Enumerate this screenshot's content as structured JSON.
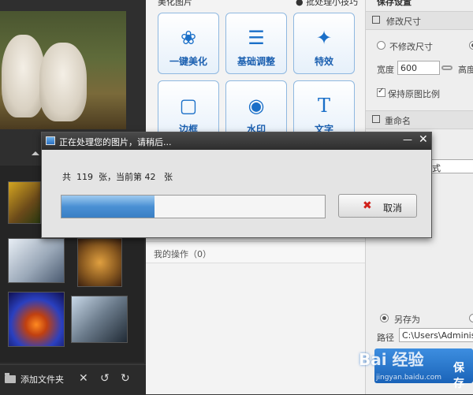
{
  "editor": {
    "section_title": "美化图片",
    "batch_label": "批处理小技巧",
    "tools": [
      {
        "label": "一键美化",
        "icon": "tulip-icon"
      },
      {
        "label": "基础调整",
        "icon": "sliders-icon"
      },
      {
        "label": "特效",
        "icon": "magic-wand-icon"
      },
      {
        "label": "边框",
        "icon": "frame-icon"
      },
      {
        "label": "水印",
        "icon": "watermark-icon"
      },
      {
        "label": "文字",
        "icon": "text-icon"
      }
    ],
    "ops_label": "我的操作（0）"
  },
  "left": {
    "add_folder_label": "添加文件夹"
  },
  "settings": {
    "title": "保存设置",
    "resize_header": "修改尺寸",
    "no_resize_label": "不修改尺寸",
    "width_label": "宽度",
    "width_value": "600",
    "height_label": "高度",
    "keep_ratio_label": "保持原图比例",
    "rename_header": "重命名",
    "format_fragment": "式",
    "save_as_label": "另存为",
    "path_label": "路径",
    "path_value": "C:\\Users\\Administra",
    "save_button": "保存"
  },
  "watermark": {
    "brand": "Bai 经验",
    "sub": "jingyan.baidu.com"
  },
  "dialog": {
    "title": "正在处理您的图片，请稍后...",
    "progress_text": "共  119  张，当前第 42   张",
    "total": 119,
    "current": 42,
    "cancel_label": "取消"
  }
}
